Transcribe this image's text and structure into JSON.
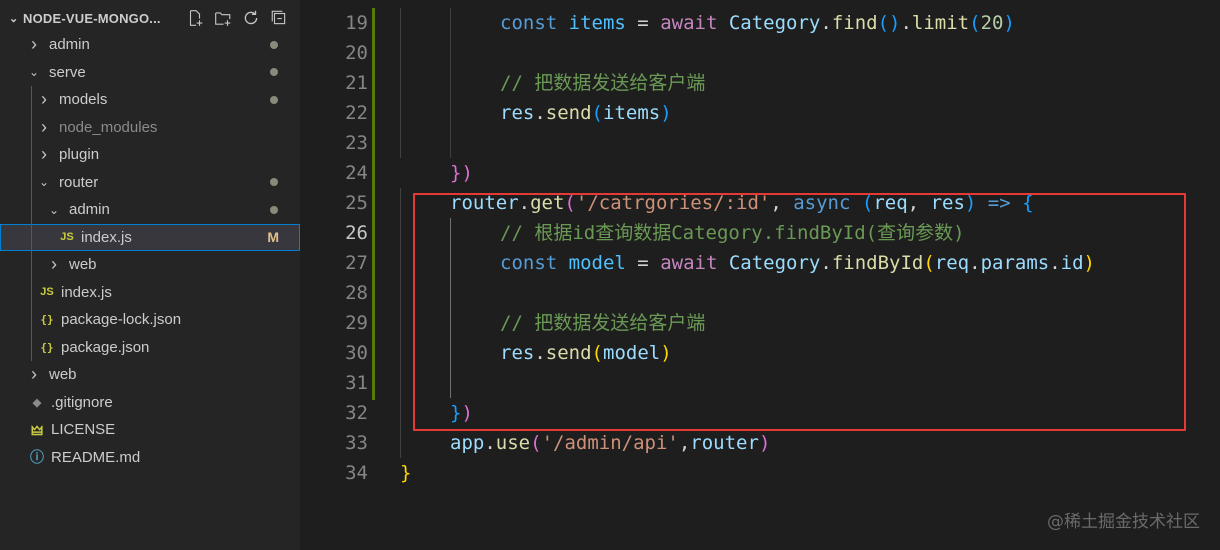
{
  "explorer": {
    "title": "NODE-VUE-MONGO...",
    "actions": [
      "new-file-icon",
      "new-folder-icon",
      "refresh-icon",
      "collapse-all-icon"
    ],
    "items": [
      {
        "label": "admin",
        "type": "folder",
        "open": false,
        "depth": 0,
        "status": "dot"
      },
      {
        "label": "serve",
        "type": "folder",
        "open": true,
        "depth": 0,
        "status": "dot"
      },
      {
        "label": "models",
        "type": "folder",
        "open": false,
        "depth": 1,
        "status": "dot"
      },
      {
        "label": "node_modules",
        "type": "folder",
        "open": false,
        "depth": 1,
        "status": "",
        "dim": true
      },
      {
        "label": "plugin",
        "type": "folder",
        "open": false,
        "depth": 1,
        "status": ""
      },
      {
        "label": "router",
        "type": "folder",
        "open": true,
        "depth": 1,
        "status": "dot"
      },
      {
        "label": "admin",
        "type": "folder",
        "open": true,
        "depth": 2,
        "status": "dot"
      },
      {
        "label": "index.js",
        "type": "js",
        "depth": 3,
        "status": "M",
        "selected": true
      },
      {
        "label": "web",
        "type": "folder",
        "open": false,
        "depth": 2,
        "status": ""
      },
      {
        "label": "index.js",
        "type": "js",
        "depth": 1,
        "status": ""
      },
      {
        "label": "package-lock.json",
        "type": "json",
        "depth": 1,
        "status": ""
      },
      {
        "label": "package.json",
        "type": "json",
        "depth": 1,
        "status": ""
      },
      {
        "label": "web",
        "type": "folder",
        "open": false,
        "depth": 0,
        "status": ""
      },
      {
        "label": ".gitignore",
        "type": "git",
        "depth": 0,
        "status": ""
      },
      {
        "label": "LICENSE",
        "type": "license",
        "depth": 0,
        "status": ""
      },
      {
        "label": "README.md",
        "type": "md",
        "depth": 0,
        "status": ""
      }
    ]
  },
  "editor": {
    "active_line": "26",
    "lines": [
      {
        "n": "19",
        "indent": 2,
        "tokens": [
          [
            "const",
            "kw"
          ],
          [
            " ",
            "op"
          ],
          [
            "items",
            "var"
          ],
          [
            " = ",
            "op"
          ],
          [
            "await",
            "ctl"
          ],
          [
            " ",
            "op"
          ],
          [
            "Category",
            "cls"
          ],
          [
            ".",
            "op"
          ],
          [
            "find",
            "fn"
          ],
          [
            "()",
            "p3"
          ],
          [
            ".",
            "op"
          ],
          [
            "limit",
            "fn"
          ],
          [
            "(",
            "p3"
          ],
          [
            "20",
            "num"
          ],
          [
            ")",
            "p3"
          ]
        ]
      },
      {
        "n": "20",
        "indent": 2,
        "tokens": []
      },
      {
        "n": "21",
        "indent": 2,
        "tokens": [
          [
            "// 把数据发送给客户端",
            "com"
          ]
        ]
      },
      {
        "n": "22",
        "indent": 2,
        "tokens": [
          [
            "res",
            "id"
          ],
          [
            ".",
            "op"
          ],
          [
            "send",
            "fn"
          ],
          [
            "(",
            "p3"
          ],
          [
            "items",
            "id"
          ],
          [
            ")",
            "p3"
          ]
        ]
      },
      {
        "n": "23",
        "indent": 2,
        "tokens": []
      },
      {
        "n": "24",
        "indent": 1,
        "tokens": [
          [
            "}",
            "p2"
          ],
          [
            ")",
            "p2"
          ]
        ]
      },
      {
        "n": "25",
        "indent": 1,
        "tokens": [
          [
            "router",
            "id"
          ],
          [
            ".",
            "op"
          ],
          [
            "get",
            "fn"
          ],
          [
            "(",
            "p2"
          ],
          [
            "'/catrgories/:id'",
            "str"
          ],
          [
            ", ",
            "op"
          ],
          [
            "async",
            "kw"
          ],
          [
            " ",
            "op"
          ],
          [
            "(",
            "p3"
          ],
          [
            "req",
            "id"
          ],
          [
            ", ",
            "op"
          ],
          [
            "res",
            "id"
          ],
          [
            ")",
            "p3"
          ],
          [
            " ",
            "op"
          ],
          [
            "=>",
            "kw"
          ],
          [
            " ",
            "op"
          ],
          [
            "{",
            "p3"
          ]
        ]
      },
      {
        "n": "26",
        "indent": 2,
        "tokens": [
          [
            "// 根据id查询数据Category.findById(查询参数)",
            "com"
          ]
        ]
      },
      {
        "n": "27",
        "indent": 2,
        "tokens": [
          [
            "const",
            "kw"
          ],
          [
            " ",
            "op"
          ],
          [
            "model",
            "var"
          ],
          [
            " = ",
            "op"
          ],
          [
            "await",
            "ctl"
          ],
          [
            " ",
            "op"
          ],
          [
            "Category",
            "cls"
          ],
          [
            ".",
            "op"
          ],
          [
            "findById",
            "fn"
          ],
          [
            "(",
            "p1"
          ],
          [
            "req",
            "id"
          ],
          [
            ".",
            "op"
          ],
          [
            "params",
            "id"
          ],
          [
            ".",
            "op"
          ],
          [
            "id",
            "id"
          ],
          [
            ")",
            "p1"
          ]
        ]
      },
      {
        "n": "28",
        "indent": 2,
        "tokens": []
      },
      {
        "n": "29",
        "indent": 2,
        "tokens": [
          [
            "// 把数据发送给客户端",
            "com"
          ]
        ]
      },
      {
        "n": "30",
        "indent": 2,
        "tokens": [
          [
            "res",
            "id"
          ],
          [
            ".",
            "op"
          ],
          [
            "send",
            "fn"
          ],
          [
            "(",
            "p1"
          ],
          [
            "model",
            "id"
          ],
          [
            ")",
            "p1"
          ]
        ]
      },
      {
        "n": "31",
        "indent": 2,
        "tokens": []
      },
      {
        "n": "32",
        "indent": 1,
        "tokens": [
          [
            "}",
            "p3"
          ],
          [
            ")",
            "p2"
          ]
        ]
      },
      {
        "n": "33",
        "indent": 1,
        "tokens": [
          [
            "app",
            "id"
          ],
          [
            ".",
            "op"
          ],
          [
            "use",
            "fn"
          ],
          [
            "(",
            "p2"
          ],
          [
            "'/admin/api'",
            "str"
          ],
          [
            ",",
            "op"
          ],
          [
            "router",
            "id"
          ],
          [
            ")",
            "p2"
          ]
        ]
      },
      {
        "n": "34",
        "indent": 0,
        "tokens": [
          [
            "}",
            "p1"
          ]
        ]
      }
    ]
  },
  "watermark": "@稀土掘金技术社区",
  "colors": {
    "highlight_box": "#e53935",
    "selection_outline": "#007fd4",
    "git_added": "#587c0c"
  }
}
